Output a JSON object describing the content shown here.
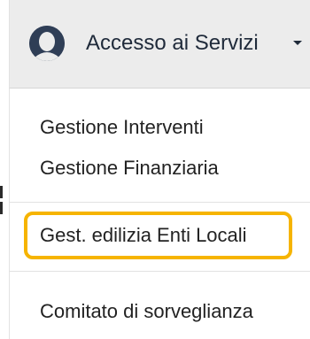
{
  "header": {
    "avatar_icon": "user-avatar-icon",
    "label": "Accesso ai Servizi",
    "caret_icon": "caret-down-icon"
  },
  "menu": {
    "items": [
      {
        "label": "Gestione Interventi"
      },
      {
        "label": "Gestione Finanziaria"
      },
      {
        "label": "Gest. edilizia Enti Locali",
        "highlighted": true
      },
      {
        "label": "Comitato di sorveglianza"
      }
    ]
  },
  "colors": {
    "header_bg": "#ececec",
    "text": "#222222",
    "highlight_border": "#f6b400",
    "avatar": "#2f3e56"
  }
}
